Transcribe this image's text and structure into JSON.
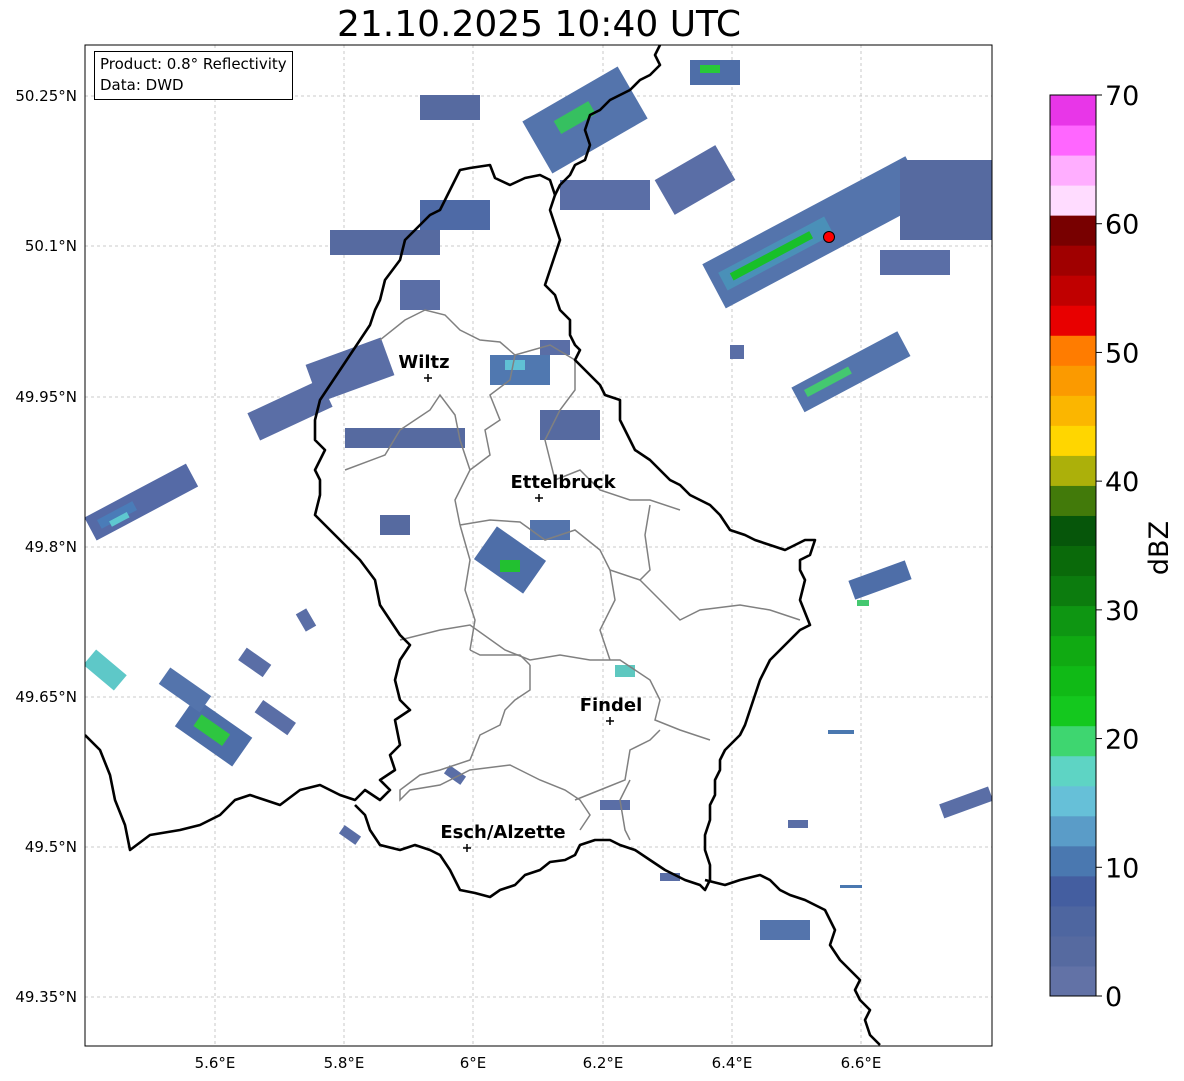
{
  "title": "21.10.2025 10:40 UTC",
  "info": {
    "product": "Product: 0.8° Reflectivity",
    "data": "Data: DWD"
  },
  "lon_labels": [
    "5.6°E",
    "5.8°E",
    "6°E",
    "6.2°E",
    "6.4°E",
    "6.6°E"
  ],
  "lat_labels": [
    "50.25°N",
    "50.1°N",
    "49.95°N",
    "49.8°N",
    "49.65°N",
    "49.5°N",
    "49.35°N"
  ],
  "cities": [
    "Wiltz",
    "Ettelbruck",
    "Findel",
    "Esch/Alzette"
  ],
  "colorbar": {
    "label": "dBZ",
    "ticks": [
      "0",
      "10",
      "20",
      "30",
      "40",
      "50",
      "60",
      "70"
    ],
    "colors": [
      "#6272a6",
      "#566aa0",
      "#4e66a0",
      "#445ea0",
      "#4a78b0",
      "#5a9cc8",
      "#66c0d8",
      "#5ed4c4",
      "#3ed670",
      "#14c81e",
      "#10ba16",
      "#10aa12",
      "#0e9612",
      "#0c7c0e",
      "#0a6a0a",
      "#06560a",
      "#427a0a",
      "#acb00a",
      "#ffd600",
      "#fbb600",
      "#fb9a00",
      "#ff7c00",
      "#e80000",
      "#c00000",
      "#a00000",
      "#780000",
      "#ffdcff",
      "#ffaeff",
      "#ff66ff",
      "#e836e8"
    ]
  },
  "colors": {
    "border": "#000000",
    "cantons": "#808080",
    "grid": "#bbbbbb",
    "radar_site": "#ff0000"
  }
}
